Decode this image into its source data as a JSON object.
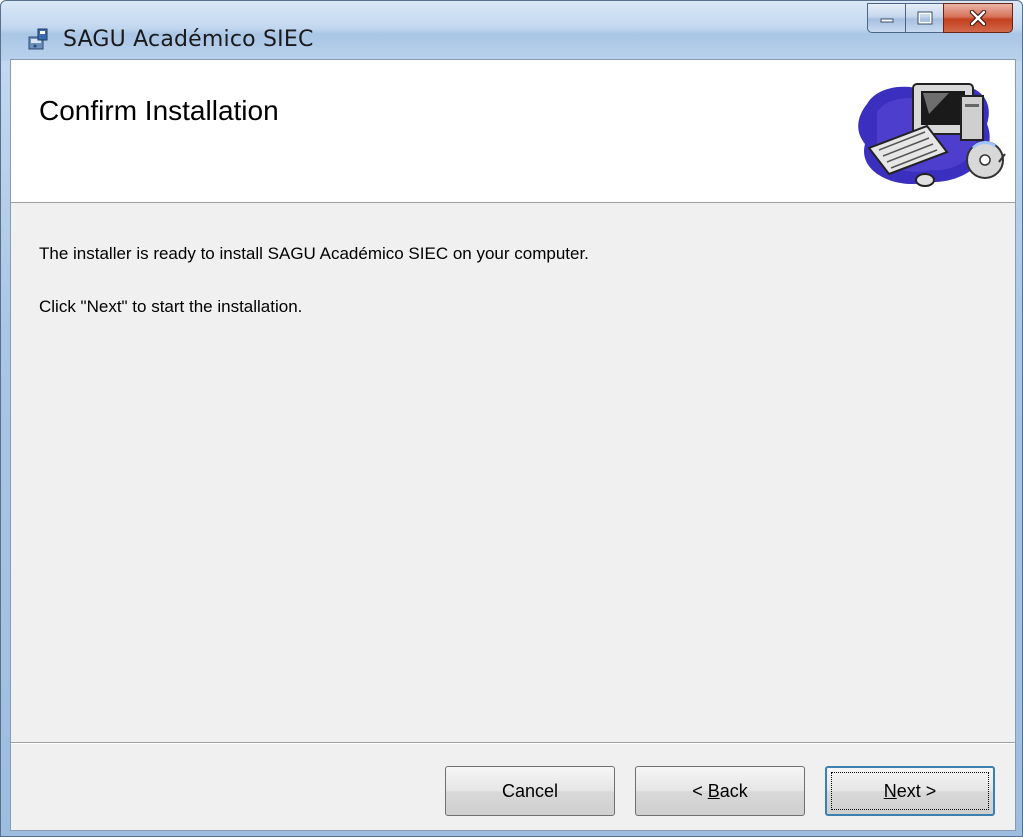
{
  "window": {
    "title": "SAGU Académico SIEC"
  },
  "header": {
    "title": "Confirm Installation"
  },
  "content": {
    "line1": "The installer is ready to install SAGU Académico SIEC on your computer.",
    "line2": "Click \"Next\" to start the installation."
  },
  "buttons": {
    "cancel": "Cancel",
    "back_prefix": "< ",
    "back_mnemonic": "B",
    "back_rest": "ack",
    "next_mnemonic": "N",
    "next_rest": "ext >"
  },
  "icons": {
    "app": "installer-icon",
    "banner": "computer-cd-graphic",
    "minimize": "minimize-icon",
    "maximize": "maximize-icon",
    "close": "close-icon"
  },
  "colors": {
    "close_button": "#c2401f",
    "focus_border": "#3c7fb1",
    "dialog_bg": "#f0f0f0"
  }
}
